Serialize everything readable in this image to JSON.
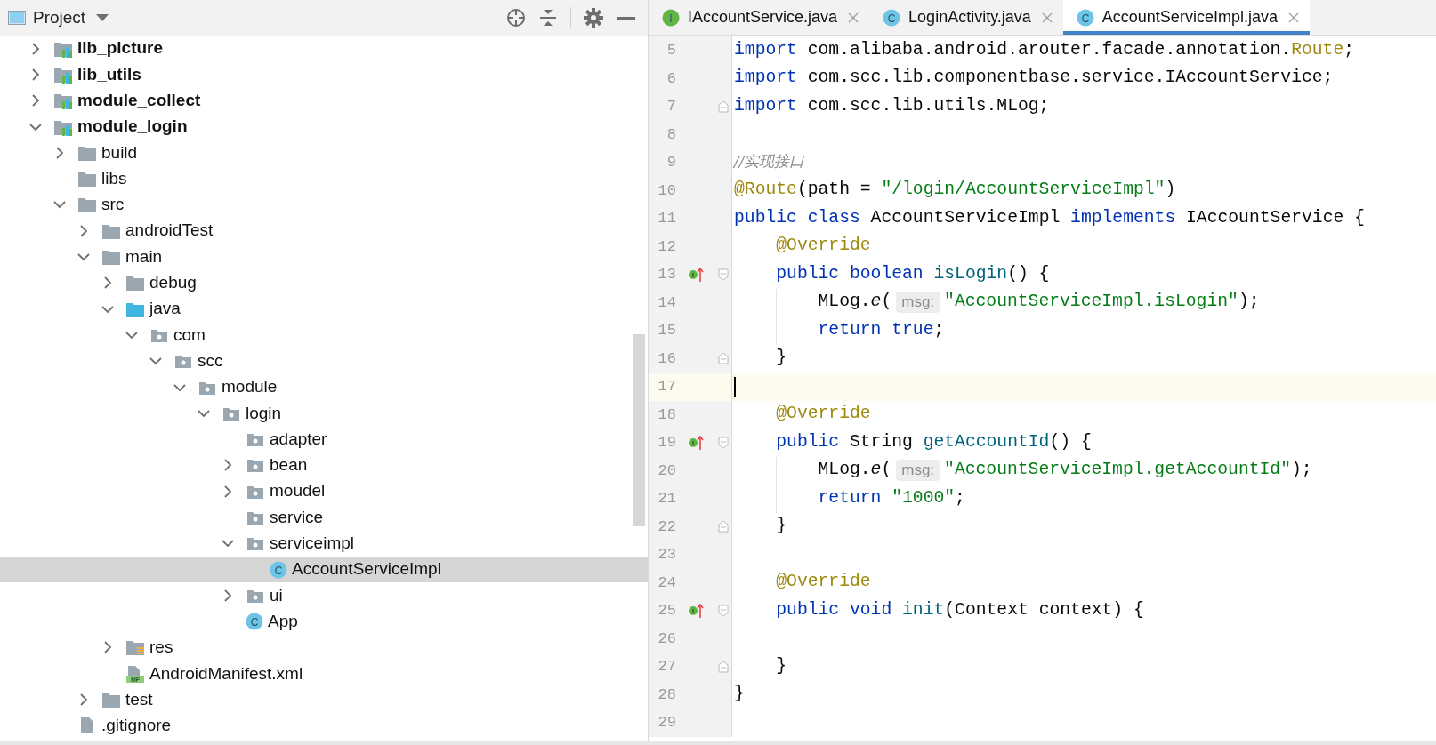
{
  "project_panel": {
    "title": "Project",
    "tree": [
      {
        "label": "lib_picture",
        "kind": "module",
        "expanded": false,
        "selected": false
      },
      {
        "label": "lib_utils",
        "kind": "module",
        "expanded": false,
        "selected": false
      },
      {
        "label": "module_collect",
        "kind": "module",
        "expanded": false,
        "selected": false
      },
      {
        "label": "module_login",
        "kind": "module",
        "expanded": true,
        "selected": false,
        "children": [
          {
            "label": "build",
            "kind": "folder",
            "expanded": false,
            "selected": false
          },
          {
            "label": "libs",
            "kind": "folder",
            "selected": false
          },
          {
            "label": "src",
            "kind": "folder",
            "expanded": true,
            "selected": false,
            "children": [
              {
                "label": "androidTest",
                "kind": "folder",
                "expanded": false,
                "selected": false
              },
              {
                "label": "main",
                "kind": "folder",
                "expanded": true,
                "selected": false,
                "children": [
                  {
                    "label": "debug",
                    "kind": "folder",
                    "expanded": false,
                    "selected": false
                  },
                  {
                    "label": "java",
                    "kind": "source",
                    "expanded": true,
                    "selected": false,
                    "children": [
                      {
                        "label": "com",
                        "kind": "package",
                        "expanded": true,
                        "selected": false,
                        "children": [
                          {
                            "label": "scc",
                            "kind": "package",
                            "expanded": true,
                            "selected": false,
                            "children": [
                              {
                                "label": "module",
                                "kind": "package",
                                "expanded": true,
                                "selected": false,
                                "children": [
                                  {
                                    "label": "login",
                                    "kind": "package",
                                    "expanded": true,
                                    "selected": false,
                                    "children": [
                                      {
                                        "label": "adapter",
                                        "kind": "package",
                                        "selected": false
                                      },
                                      {
                                        "label": "bean",
                                        "kind": "package",
                                        "expanded": false,
                                        "selected": false
                                      },
                                      {
                                        "label": "moudel",
                                        "kind": "package",
                                        "expanded": false,
                                        "selected": false
                                      },
                                      {
                                        "label": "service",
                                        "kind": "package",
                                        "selected": false
                                      },
                                      {
                                        "label": "serviceimpl",
                                        "kind": "package",
                                        "expanded": true,
                                        "selected": false,
                                        "children": [
                                          {
                                            "label": "AccountServiceImpl",
                                            "kind": "class",
                                            "badge": "C",
                                            "selected": true
                                          }
                                        ]
                                      },
                                      {
                                        "label": "ui",
                                        "kind": "package",
                                        "expanded": false,
                                        "selected": false
                                      },
                                      {
                                        "label": "App",
                                        "kind": "class",
                                        "badge": "C",
                                        "selected": false
                                      }
                                    ]
                                  }
                                ]
                              }
                            ]
                          }
                        ]
                      }
                    ]
                  },
                  {
                    "label": "res",
                    "kind": "res",
                    "expanded": false,
                    "selected": false
                  },
                  {
                    "label": "AndroidManifest.xml",
                    "kind": "manifest",
                    "badge": "MF",
                    "selected": false
                  }
                ]
              },
              {
                "label": "test",
                "kind": "folder",
                "expanded": false,
                "selected": false
              }
            ]
          },
          {
            "label": ".gitignore",
            "kind": "file",
            "selected": false
          }
        ]
      }
    ]
  },
  "editor": {
    "tabs": [
      {
        "label": "IAccountService.java",
        "kind": "interface",
        "badge": "I",
        "selected": false
      },
      {
        "label": "LoginActivity.java",
        "kind": "class",
        "badge": "C",
        "selected": false
      },
      {
        "label": "AccountServiceImpl.java",
        "kind": "class",
        "badge": "C",
        "selected": true
      }
    ],
    "lines": [
      {
        "number": "5",
        "tokens": [
          {
            "text": "import",
            "kind": "keyword"
          },
          {
            "text": " com.alibaba.android.arouter.facade.annotation.",
            "kind": "plain"
          },
          {
            "text": "Route",
            "kind": "annotation"
          },
          {
            "text": ";",
            "kind": "plain"
          }
        ]
      },
      {
        "number": "6",
        "tokens": [
          {
            "text": "import",
            "kind": "keyword"
          },
          {
            "text": " com.scc.lib.componentbase.service.IAccountService;",
            "kind": "plain"
          }
        ]
      },
      {
        "number": "7",
        "fold_end": true,
        "tokens": [
          {
            "text": "import",
            "kind": "keyword"
          },
          {
            "text": " com.scc.lib.utils.MLog;",
            "kind": "plain"
          }
        ]
      },
      {
        "number": "8"
      },
      {
        "number": "9",
        "tokens": [
          {
            "text": "//实现接口",
            "kind": "comment"
          }
        ]
      },
      {
        "number": "10",
        "tokens": [
          {
            "text": "@Route",
            "kind": "annotation"
          },
          {
            "text": "(path = ",
            "kind": "plain"
          },
          {
            "text": "\"/login/AccountServiceImpl\"",
            "kind": "string"
          },
          {
            "text": ")",
            "kind": "plain"
          }
        ]
      },
      {
        "number": "11",
        "tokens": [
          {
            "text": "public class",
            "kind": "keyword"
          },
          {
            "text": " AccountServiceImpl ",
            "kind": "plain"
          },
          {
            "text": "implements",
            "kind": "keyword"
          },
          {
            "text": " IAccountService {",
            "kind": "plain"
          }
        ]
      },
      {
        "number": "12",
        "tokens": [
          {
            "text": "    @Override",
            "kind": "annotation"
          }
        ]
      },
      {
        "number": "13",
        "marker": "I",
        "fold_start": true,
        "tokens": [
          {
            "text": "    public boolean ",
            "kind": "keyword"
          },
          {
            "text": "isLogin",
            "kind": "method"
          },
          {
            "text": "() {",
            "kind": "plain"
          }
        ]
      },
      {
        "number": "14",
        "tokens": [
          {
            "text": "        MLog.",
            "kind": "plain"
          },
          {
            "text": "e",
            "kind": "italic"
          },
          {
            "text": "(",
            "kind": "plain"
          },
          {
            "text": "msg:",
            "kind": "hint"
          },
          {
            "text": "\"AccountServiceImpl.isLogin\"",
            "kind": "string"
          },
          {
            "text": ");",
            "kind": "plain"
          }
        ]
      },
      {
        "number": "15",
        "tokens": [
          {
            "text": "        return true",
            "kind": "keyword"
          },
          {
            "text": ";",
            "kind": "plain"
          }
        ]
      },
      {
        "number": "16",
        "fold_end": true,
        "tokens": [
          {
            "text": "    }",
            "kind": "plain"
          }
        ]
      },
      {
        "number": "17",
        "current": true
      },
      {
        "number": "18",
        "tokens": [
          {
            "text": "    @Override",
            "kind": "annotation"
          }
        ]
      },
      {
        "number": "19",
        "marker": "I",
        "fold_start": true,
        "tokens": [
          {
            "text": "    public",
            "kind": "keyword"
          },
          {
            "text": " String ",
            "kind": "plain"
          },
          {
            "text": "getAccountId",
            "kind": "method"
          },
          {
            "text": "() {",
            "kind": "plain"
          }
        ]
      },
      {
        "number": "20",
        "tokens": [
          {
            "text": "        MLog.",
            "kind": "plain"
          },
          {
            "text": "e",
            "kind": "italic"
          },
          {
            "text": "(",
            "kind": "plain"
          },
          {
            "text": "msg:",
            "kind": "hint"
          },
          {
            "text": "\"AccountServiceImpl.getAccountId\"",
            "kind": "string"
          },
          {
            "text": ");",
            "kind": "plain"
          }
        ]
      },
      {
        "number": "21",
        "tokens": [
          {
            "text": "        return ",
            "kind": "keyword"
          },
          {
            "text": "\"1000\"",
            "kind": "string"
          },
          {
            "text": ";",
            "kind": "plain"
          }
        ]
      },
      {
        "number": "22",
        "fold_end": true,
        "tokens": [
          {
            "text": "    }",
            "kind": "plain"
          }
        ]
      },
      {
        "number": "23"
      },
      {
        "number": "24",
        "tokens": [
          {
            "text": "    @Override",
            "kind": "annotation"
          }
        ]
      },
      {
        "number": "25",
        "marker": "I",
        "fold_start": true,
        "tokens": [
          {
            "text": "    public void ",
            "kind": "keyword"
          },
          {
            "text": "init",
            "kind": "method"
          },
          {
            "text": "(Context context) {",
            "kind": "plain"
          }
        ]
      },
      {
        "number": "26"
      },
      {
        "number": "27",
        "fold_end": true,
        "tokens": [
          {
            "text": "    }",
            "kind": "plain"
          }
        ]
      },
      {
        "number": "28",
        "tokens": [
          {
            "text": "}",
            "kind": "plain"
          }
        ]
      },
      {
        "number": "29"
      }
    ]
  }
}
